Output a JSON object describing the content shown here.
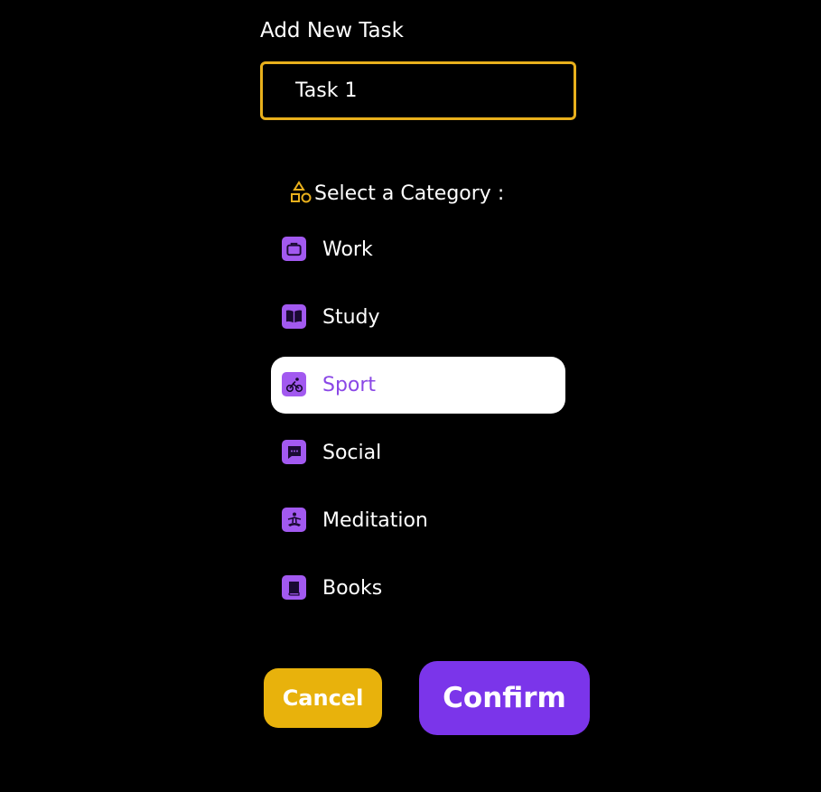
{
  "dialog": {
    "title": "Add New Task",
    "task_input": {
      "value": "Task 1",
      "placeholder": ""
    },
    "category_heading": {
      "icon": "shapes-icon",
      "label": "Select a Category :"
    },
    "categories": [
      {
        "label": "Work",
        "icon": "briefcase-icon",
        "selected": false
      },
      {
        "label": "Study",
        "icon": "book-open-icon",
        "selected": false
      },
      {
        "label": "Sport",
        "icon": "bicycle-icon",
        "selected": true
      },
      {
        "label": "Social",
        "icon": "chat-bubble-icon",
        "selected": false
      },
      {
        "label": "Meditation",
        "icon": "meditation-icon",
        "selected": false
      },
      {
        "label": "Books",
        "icon": "book-icon",
        "selected": false
      }
    ],
    "buttons": {
      "cancel_label": "Cancel",
      "confirm_label": "Confirm"
    }
  },
  "colors": {
    "background": "#000000",
    "accent_yellow": "#e9b01c",
    "accent_purple": "#7b35ea",
    "icon_purple": "#a259f0",
    "selected_text": "#8a47e6",
    "text": "#ffffff"
  }
}
